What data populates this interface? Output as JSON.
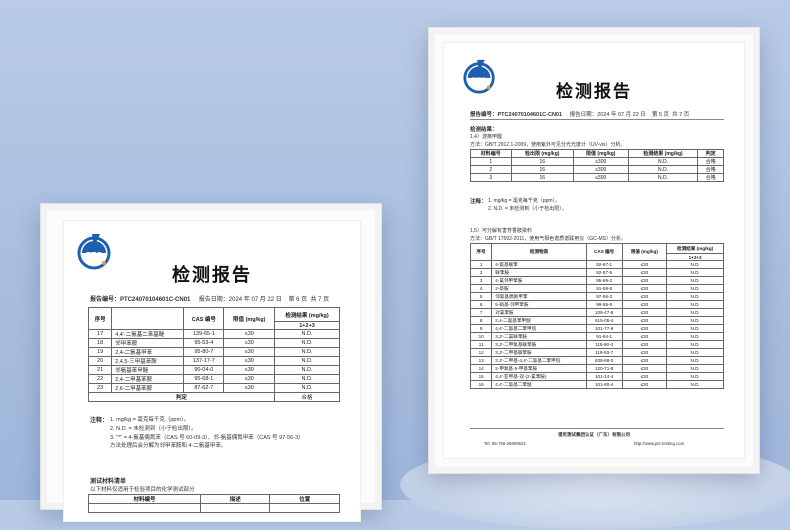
{
  "left_report": {
    "title": "检测报告",
    "report_no_label": "报告编号：",
    "report_no": "PTC24070104601C-CN01",
    "date_label": "报告日期：",
    "date": "2024 年 07 月 22 日",
    "page": "第 6 页",
    "total": "共 7 页",
    "headers": [
      "序号",
      "CAS 编号",
      "限值 (mg/kg)",
      "检测结果 (mg/kg)",
      "1+2+3"
    ],
    "rows": [
      [
        "17",
        "4,4'-二氨基二苯基醚",
        "139-65-1",
        "≤30",
        "N.D."
      ],
      [
        "18",
        "邻甲苯胺",
        "95-53-4",
        "≤30",
        "N.D."
      ],
      [
        "19",
        "2,4-二氨基甲苯",
        "95-80-7",
        "≤30",
        "N.D."
      ],
      [
        "20",
        "2,4,5-三甲基苯胺",
        "137-17-7",
        "≤30",
        "N.D."
      ],
      [
        "21",
        "邻氨基苯甲醚",
        "90-04-0",
        "≤30",
        "N.D."
      ],
      [
        "22",
        "2,4-二甲基苯胺",
        "95-68-1",
        "≤30",
        "N.D."
      ],
      [
        "23",
        "2,6-二甲基苯胺",
        "87-62-7",
        "≤30",
        "N.D."
      ]
    ],
    "verdict_label": "判定",
    "verdict_value": "合格",
    "notes_label": "注释：",
    "notes": [
      "1.   mg/kg = 毫克每千克（ppm）。",
      "2.   N.D. = 未检测到（小于检出限）。",
      "3.   \"*\" = 4-氨基偶氮苯（CAS 号 60-09-3）、邻-氨基偶氮甲苯（CAS 号 97-56-3）",
      "     方法处理后会分解为邻甲苯胺和 4-二氨基甲苯。"
    ],
    "sample_label": "测试材料清单",
    "sample_sub": "以下材料仅适用于检验项目的化学测试部分",
    "sample_headers": [
      "材料编号",
      "描述",
      "位置"
    ]
  },
  "right_report": {
    "title": "检测报告",
    "report_no_label": "报告编号：",
    "report_no": "PTC24070104601C-CN01",
    "date_label": "报告日期：",
    "date": "2024 年 07 月 22 日",
    "page": "第 5 页",
    "total": "共 7 页",
    "section1_label": "检测结果：",
    "section1_title": "1.4）游离甲醛",
    "section1_method": "方法：GB/T 2912.1-2009，使用紫外可见分光光度计（UV-vis）分析。",
    "t1_headers": [
      "材料编号",
      "检出限 (mg/kg)",
      "限值 (mg/kg)",
      "检测结果 (mg/kg)",
      "判定"
    ],
    "t1_rows": [
      [
        "1",
        "16",
        "≤300",
        "N.D.",
        "合格"
      ],
      [
        "2",
        "16",
        "≤300",
        "N.D.",
        "合格"
      ],
      [
        "3",
        "16",
        "≤300",
        "N.D.",
        "合格"
      ]
    ],
    "notes_label": "注释：",
    "notes": [
      "1.   mg/kg = 毫克每千克（ppm）。",
      "2.   N.D. = 未检测到（小于检出限）。"
    ],
    "section2_title": "1.5）可分解有害芳香胺染料",
    "section2_method": "方法：GB/T 17592-2011，使用气相色谱质谱联用仪（GC-MS）分析。",
    "t2_headers": [
      "序号",
      "检测物质",
      "CAS 编号",
      "限值 (mg/kg)",
      "检测结果 (mg/kg)",
      "1+2+3"
    ],
    "t2_rows": [
      [
        "1",
        "4-氨基联苯",
        "92-67-1",
        "≤30",
        "N.D."
      ],
      [
        "2",
        "联苯胺",
        "92-87-5",
        "≤30",
        "N.D."
      ],
      [
        "3",
        "4-氯邻甲苯胺",
        "95-69-2",
        "≤30",
        "N.D."
      ],
      [
        "4",
        "2-萘胺",
        "91-59-8",
        "≤30",
        "N.D."
      ],
      [
        "5",
        "邻氨基偶氮甲苯",
        "97-56-3",
        "≤30",
        "N.D."
      ],
      [
        "6",
        "5-硝基-邻甲苯胺",
        "99-55-8",
        "≤30",
        "N.D."
      ],
      [
        "7",
        "对氯苯胺",
        "106-47-8",
        "≤30",
        "N.D."
      ],
      [
        "8",
        "2,4-二氨基苯甲醚",
        "615-05-4",
        "≤30",
        "N.D."
      ],
      [
        "9",
        "4,4'-二氨基二苯甲烷",
        "101-77-9",
        "≤30",
        "N.D."
      ],
      [
        "10",
        "3,3'-二氯联苯胺",
        "91-94-1",
        "≤30",
        "N.D."
      ],
      [
        "11",
        "3,3'-二甲氧基联苯胺",
        "119-90-4",
        "≤30",
        "N.D."
      ],
      [
        "12",
        "3,3'-二甲基联苯胺",
        "119-93-7",
        "≤30",
        "N.D."
      ],
      [
        "13",
        "3,3'-二甲基-4,4'-二氨基二苯甲烷",
        "838-88-0",
        "≤30",
        "N.D."
      ],
      [
        "14",
        "2-甲氧基-5-甲基苯胺",
        "120-71-8",
        "≤30",
        "N.D."
      ],
      [
        "15",
        "4,4'-亚甲基-双-(2-氯苯胺)",
        "101-14-4",
        "≤30",
        "N.D."
      ],
      [
        "16",
        "4,4'-二氨基二苯醚",
        "101-80-4",
        "≤30",
        "N.D."
      ]
    ],
    "footer_company": "谱尼测试集团认证（广东）有限公司",
    "footer_tel": "Tel: 86-755-26609622",
    "footer_web": "http://www.ptc-testing.com"
  },
  "logo_text": "PTC",
  "colors": {
    "logo_blue": "#1f5fae",
    "logo_gold": "#d9a53a",
    "background": "#aec2e0"
  }
}
